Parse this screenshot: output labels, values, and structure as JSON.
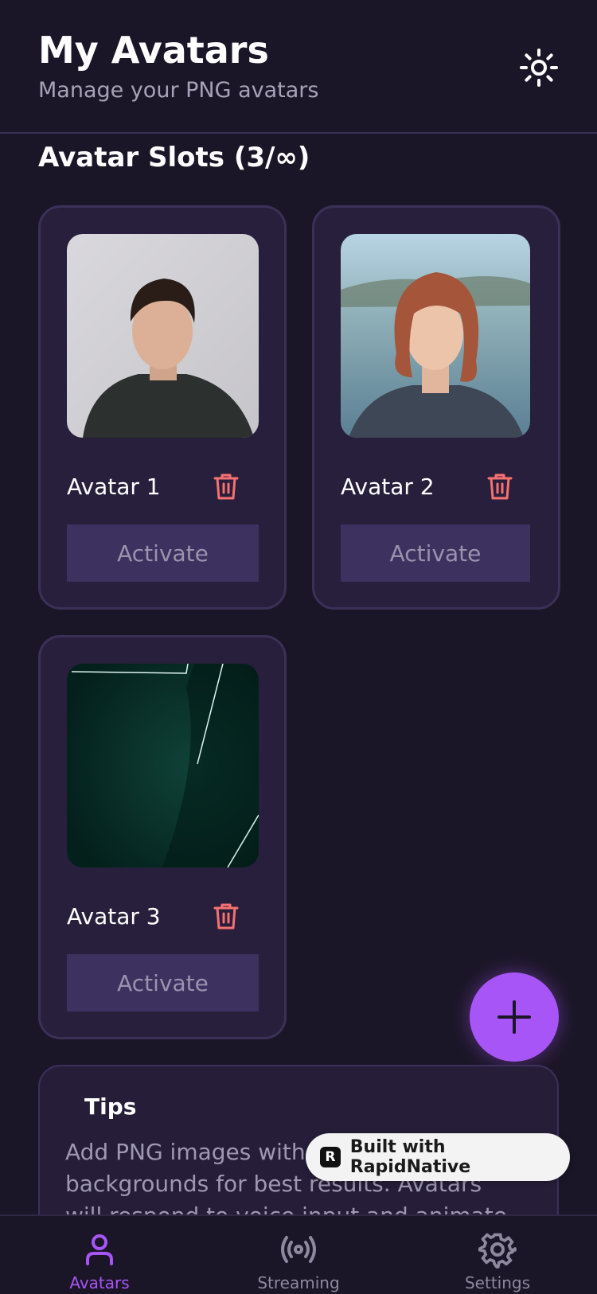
{
  "header": {
    "title": "My Avatars",
    "subtitle": "Manage your PNG avatars",
    "theme_icon": "sun-icon"
  },
  "section": {
    "title": "Avatar Slots (3/∞)"
  },
  "avatars": [
    {
      "name": "Avatar 1",
      "button": "Activate",
      "image": "portrait-man"
    },
    {
      "name": "Avatar 2",
      "button": "Activate",
      "image": "portrait-woman"
    },
    {
      "name": "Avatar 3",
      "button": "Activate",
      "image": "dark-abstract"
    }
  ],
  "fab": {
    "icon": "plus-icon"
  },
  "tips": {
    "title": "Tips",
    "text": "Add PNG images with transparent backgrounds for best results. Avatars will respond to voice input and animate based"
  },
  "badge": {
    "label": "Built with RapidNative",
    "logo": "R"
  },
  "tabs": [
    {
      "label": "Avatars",
      "icon": "user-icon",
      "active": true
    },
    {
      "label": "Streaming",
      "icon": "broadcast-icon",
      "active": false
    },
    {
      "label": "Settings",
      "icon": "gear-icon",
      "active": false
    }
  ],
  "colors": {
    "background": "#1b1627",
    "card": "#271f3b",
    "accent": "#a855f7",
    "delete": "#f87171",
    "button": "#3d3160"
  }
}
